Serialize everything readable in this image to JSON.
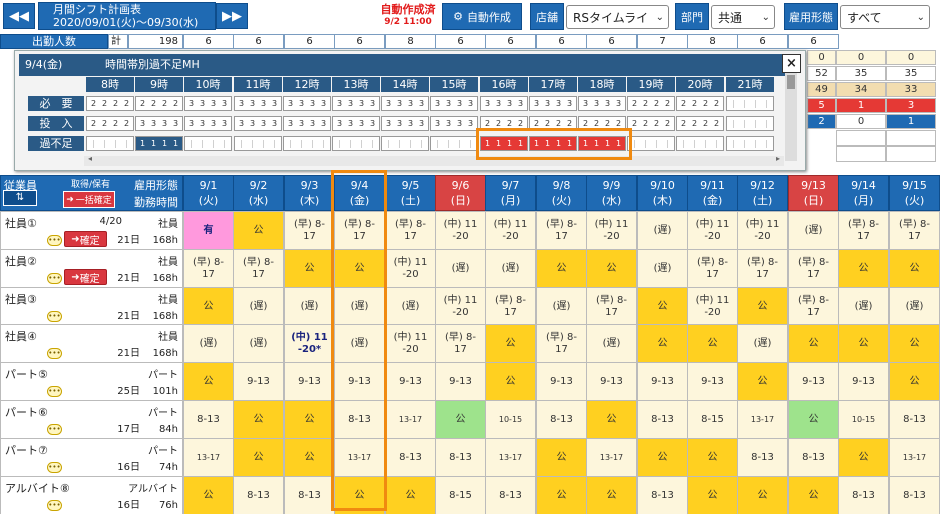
{
  "header": {
    "prev_icon": "double-left-arrow",
    "next_icon": "double-right-arrow",
    "title": "月間シフト計画表",
    "range": "2020/09/01(火)〜09/30(水)",
    "status_label": "自動作成済",
    "status_time": "9/2 11:00",
    "auto_button": "自動作成",
    "store_label": "店舗",
    "store_value": "RSタイムライ",
    "dept_label": "部門",
    "dept_value": "共通",
    "emp_type_label": "雇用形態",
    "emp_type_value": "すべて"
  },
  "attendance": {
    "label": "出勤人数",
    "total_label": "計",
    "total": "198",
    "values": [
      "6",
      "6",
      "6",
      "6",
      "8",
      "6",
      "6",
      "6",
      "6",
      "7",
      "8",
      "6",
      "6"
    ]
  },
  "right_partial": {
    "rows": [
      [
        "0",
        "0",
        "0"
      ],
      [
        "52",
        "35",
        "35"
      ],
      [
        "49",
        "34",
        "33"
      ],
      [
        "5",
        "1",
        "3"
      ],
      [
        "2",
        "0",
        "1"
      ]
    ]
  },
  "popup": {
    "date": "9/4(金)",
    "title": "時間帯別過不足MH",
    "hours": [
      "8時",
      "9時",
      "10時",
      "11時",
      "12時",
      "13時",
      "14時",
      "15時",
      "16時",
      "17時",
      "18時",
      "19時",
      "20時",
      "21時"
    ],
    "row_labels": [
      "必　要",
      "投　入",
      "過不足"
    ],
    "required": [
      "2222",
      "2222",
      "3333",
      "3333",
      "3333",
      "3333",
      "3333",
      "3333",
      "3333",
      "3333",
      "3333",
      "2222",
      "2222",
      ""
    ],
    "assigned": [
      "2222",
      "3333",
      "3333",
      "3333",
      "3333",
      "3333",
      "3333",
      "3333",
      "2222",
      "2222",
      "2222",
      "2222",
      "2222",
      ""
    ],
    "diff": [
      "",
      "1111",
      "",
      "",
      "",
      "",
      "",
      "",
      "-1-1-1-1",
      "-1-1-1-1",
      "-1-1-1-1",
      "",
      "",
      ""
    ],
    "close_label": "×"
  },
  "calendar": {
    "emp_header": {
      "employee": "従業員",
      "taken": "取得/保有",
      "bulk_confirm": "一括確定",
      "type": "雇用形態",
      "hours": "勤務時間",
      "sort_icon": "sort-icon"
    },
    "days": [
      {
        "d": "9/1",
        "w": "(火)",
        "red": false
      },
      {
        "d": "9/2",
        "w": "(水)",
        "red": false
      },
      {
        "d": "9/3",
        "w": "(木)",
        "red": false
      },
      {
        "d": "9/4",
        "w": "(金)",
        "red": false
      },
      {
        "d": "9/5",
        "w": "(土)",
        "red": false
      },
      {
        "d": "9/6",
        "w": "(日)",
        "red": true
      },
      {
        "d": "9/7",
        "w": "(月)",
        "red": false
      },
      {
        "d": "9/8",
        "w": "(火)",
        "red": false
      },
      {
        "d": "9/9",
        "w": "(水)",
        "red": false
      },
      {
        "d": "9/10",
        "w": "(木)",
        "red": false
      },
      {
        "d": "9/11",
        "w": "(金)",
        "red": false
      },
      {
        "d": "9/12",
        "w": "(土)",
        "red": false
      },
      {
        "d": "9/13",
        "w": "(日)",
        "red": true
      },
      {
        "d": "9/14",
        "w": "(月)",
        "red": false
      },
      {
        "d": "9/15",
        "w": "(火)",
        "red": false
      }
    ],
    "employees": [
      {
        "name": "社員①",
        "type": "社員",
        "days": "21日",
        "hours": "168h",
        "date": "4/20",
        "confirm": "確定"
      },
      {
        "name": "社員②",
        "type": "社員",
        "days": "21日",
        "hours": "168h",
        "date": "",
        "confirm": "確定"
      },
      {
        "name": "社員③",
        "type": "社員",
        "days": "21日",
        "hours": "168h",
        "date": "",
        "confirm": ""
      },
      {
        "name": "社員④",
        "type": "社員",
        "days": "21日",
        "hours": "168h",
        "date": "",
        "confirm": ""
      },
      {
        "name": "パート⑤",
        "type": "パート",
        "days": "25日",
        "hours": "101h",
        "date": "",
        "confirm": ""
      },
      {
        "name": "パート⑥",
        "type": "パート",
        "days": "17日",
        "hours": "84h",
        "date": "",
        "confirm": ""
      },
      {
        "name": "パート⑦",
        "type": "パート",
        "days": "16日",
        "hours": "74h",
        "date": "",
        "confirm": ""
      },
      {
        "name": "アルバイト⑧",
        "type": "アルバイト",
        "days": "16日",
        "hours": "76h",
        "date": "",
        "confirm": ""
      }
    ],
    "cells": [
      [
        [
          "有",
          "pink"
        ],
        [
          "公",
          "yellow"
        ],
        [
          "(早) 8-\n17",
          "cream"
        ],
        [
          "(早) 8-\n17",
          "cream"
        ],
        [
          "(早) 8-\n17",
          "cream"
        ],
        [
          "(中) 11\n-20",
          "cream"
        ],
        [
          "(中) 11\n-20",
          "cream"
        ],
        [
          "(早) 8-\n17",
          "cream"
        ],
        [
          "(中) 11\n-20",
          "cream"
        ],
        [
          "(遅)",
          "cream"
        ],
        [
          "(中) 11\n-20",
          "cream"
        ],
        [
          "(中) 11\n-20",
          "cream"
        ],
        [
          "(遅)",
          "cream"
        ],
        [
          "(早) 8-\n17",
          "cream"
        ],
        [
          "(早) 8-\n17",
          "cream"
        ]
      ],
      [
        [
          "(早) 8-\n17",
          "cream"
        ],
        [
          "(早) 8-\n17",
          "cream"
        ],
        [
          "公",
          "yellow"
        ],
        [
          "公",
          "yellow"
        ],
        [
          "(中) 11\n-20",
          "cream"
        ],
        [
          "(遅)",
          "cream"
        ],
        [
          "(遅)",
          "cream"
        ],
        [
          "公",
          "yellow"
        ],
        [
          "公",
          "yellow"
        ],
        [
          "(遅)",
          "cream"
        ],
        [
          "(早) 8-\n17",
          "cream"
        ],
        [
          "(早) 8-\n17",
          "cream"
        ],
        [
          "(早) 8-\n17",
          "cream"
        ],
        [
          "公",
          "yellow"
        ],
        [
          "公",
          "yellow"
        ]
      ],
      [
        [
          "公",
          "yellow"
        ],
        [
          "(遅)",
          "cream"
        ],
        [
          "(遅)",
          "cream"
        ],
        [
          "(遅)",
          "cream"
        ],
        [
          "(遅)",
          "cream"
        ],
        [
          "(中) 11\n-20",
          "cream"
        ],
        [
          "(早) 8-\n17",
          "cream"
        ],
        [
          "(遅)",
          "cream"
        ],
        [
          "(早) 8-\n17",
          "cream"
        ],
        [
          "公",
          "yellow"
        ],
        [
          "(中) 11\n-20",
          "cream"
        ],
        [
          "公",
          "yellow"
        ],
        [
          "(早) 8-\n17",
          "cream"
        ],
        [
          "(遅)",
          "cream"
        ],
        [
          "(遅)",
          "cream"
        ]
      ],
      [
        [
          "(遅)",
          "cream"
        ],
        [
          "(遅)",
          "cream"
        ],
        [
          "(中) 11\n-20*",
          "boldcream"
        ],
        [
          "(遅)",
          "cream"
        ],
        [
          "(中) 11\n-20",
          "cream"
        ],
        [
          "(早) 8-\n17",
          "cream"
        ],
        [
          "公",
          "yellow"
        ],
        [
          "(早) 8-\n17",
          "cream"
        ],
        [
          "(遅)",
          "cream"
        ],
        [
          "公",
          "yellow"
        ],
        [
          "公",
          "yellow"
        ],
        [
          "(遅)",
          "cream"
        ],
        [
          "公",
          "yellow"
        ],
        [
          "公",
          "yellow"
        ],
        [
          "公",
          "yellow"
        ]
      ],
      [
        [
          "公",
          "yellow"
        ],
        [
          "9-13",
          "cream"
        ],
        [
          "9-13",
          "cream"
        ],
        [
          "9-13",
          "cream"
        ],
        [
          "9-13",
          "cream"
        ],
        [
          "9-13",
          "cream"
        ],
        [
          "公",
          "yellow"
        ],
        [
          "9-13",
          "cream"
        ],
        [
          "9-13",
          "cream"
        ],
        [
          "9-13",
          "cream"
        ],
        [
          "9-13",
          "cream"
        ],
        [
          "公",
          "yellow"
        ],
        [
          "9-13",
          "cream"
        ],
        [
          "9-13",
          "cream"
        ],
        [
          "公",
          "yellow"
        ]
      ],
      [
        [
          "8-13",
          "cream"
        ],
        [
          "公",
          "yellow"
        ],
        [
          "公",
          "yellow"
        ],
        [
          "8-13",
          "cream"
        ],
        [
          "13-17",
          "smallcream"
        ],
        [
          "公",
          "green"
        ],
        [
          "10-15",
          "smallcream"
        ],
        [
          "8-13",
          "cream"
        ],
        [
          "公",
          "yellow"
        ],
        [
          "8-13",
          "cream"
        ],
        [
          "8-15",
          "cream"
        ],
        [
          "13-17",
          "smallcream"
        ],
        [
          "公",
          "green"
        ],
        [
          "10-15",
          "smallcream"
        ],
        [
          "8-13",
          "cream"
        ]
      ],
      [
        [
          "13-17",
          "smallcream"
        ],
        [
          "公",
          "yellow"
        ],
        [
          "公",
          "yellow"
        ],
        [
          "13-17",
          "smallcream"
        ],
        [
          "8-13",
          "cream"
        ],
        [
          "8-13",
          "cream"
        ],
        [
          "13-17",
          "smallcream"
        ],
        [
          "公",
          "yellow"
        ],
        [
          "13-17",
          "smallcream"
        ],
        [
          "公",
          "yellow"
        ],
        [
          "公",
          "yellow"
        ],
        [
          "8-13",
          "cream"
        ],
        [
          "8-13",
          "cream"
        ],
        [
          "公",
          "yellow"
        ],
        [
          "13-17",
          "smallcream"
        ]
      ],
      [
        [
          "公",
          "yellow"
        ],
        [
          "8-13",
          "cream"
        ],
        [
          "8-13",
          "cream"
        ],
        [
          "公",
          "yellow"
        ],
        [
          "公",
          "yellow"
        ],
        [
          "8-15",
          "cream"
        ],
        [
          "8-13",
          "cream"
        ],
        [
          "公",
          "yellow"
        ],
        [
          "公",
          "yellow"
        ],
        [
          "8-13",
          "cream"
        ],
        [
          "公",
          "yellow"
        ],
        [
          "公",
          "yellow"
        ],
        [
          "公",
          "yellow"
        ],
        [
          "8-13",
          "cream"
        ],
        [
          "8-13",
          "cream"
        ]
      ]
    ]
  },
  "colors": {
    "primary": "#1f6ab3",
    "sunday": "#d84444",
    "dayoff": "#ffd020",
    "highlight": "#f08a10"
  }
}
